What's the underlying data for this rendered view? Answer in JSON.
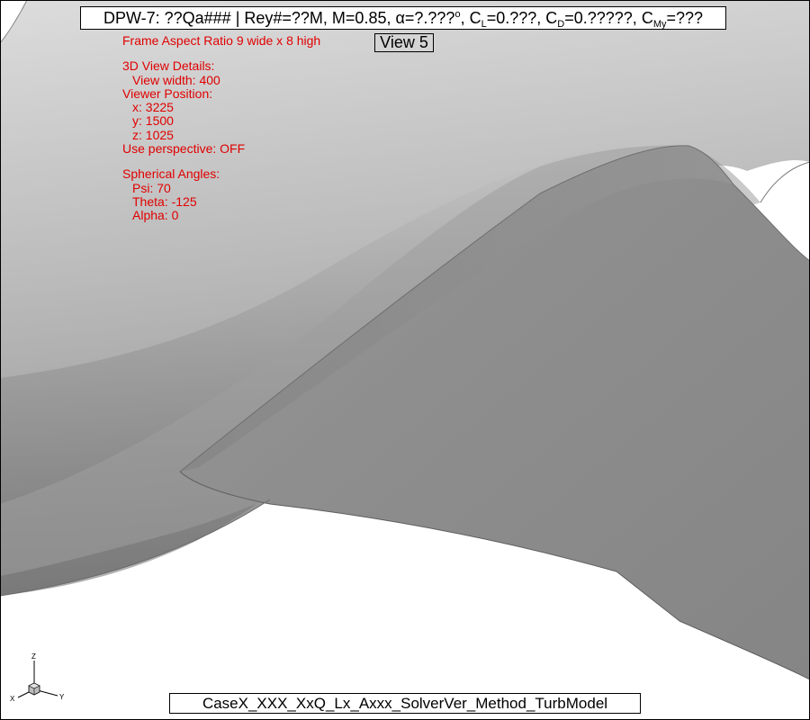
{
  "title": {
    "prefix": "DPW-7: ??Qa### | Rey#=??M, M=0.85, ",
    "alpha_symbol": "α",
    "alpha_value": "=?.???",
    "deg": "o",
    "cl_letter": "C",
    "cl_sub": "L",
    "cl_value": "=0.???, ",
    "cd_letter": "C",
    "cd_sub": "D",
    "cd_value": "=0.?????, ",
    "cmy_letter": "C",
    "cmy_sub": "My",
    "cmy_value": "=???"
  },
  "view_button": {
    "label": "View 5"
  },
  "info": {
    "frame_aspect": "Frame Aspect Ratio 9 wide x 8 high",
    "view_details_heading": "3D View Details:",
    "view_width": "View width: 400",
    "viewer_position_heading": "Viewer Position:",
    "x": "x: 3225",
    "y": "y: 1500",
    "z": "z: 1025",
    "perspective": "Use perspective: OFF",
    "spherical_heading": "Spherical Angles:",
    "psi": "Psi: 70",
    "theta": "Theta: -125",
    "alpha": "Alpha: 0"
  },
  "footer": {
    "case_label": "CaseX_XXX_XxQ_Lx_Axxx_SolverVer_Method_TurbModel"
  },
  "triad": {
    "z": "Z",
    "x": "X",
    "y": "Y"
  },
  "colors": {
    "annotation_red": "#e00000",
    "surface_gray": "#8c8c8c",
    "background": "#ffffff"
  }
}
